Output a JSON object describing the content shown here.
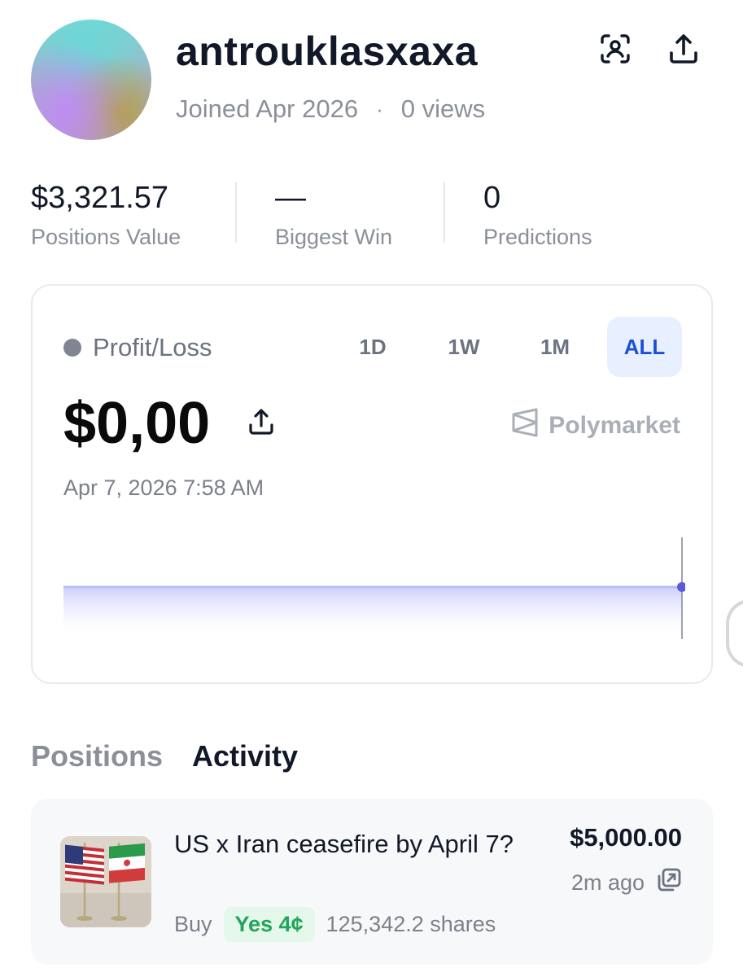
{
  "profile": {
    "username": "antrouklasxaxa",
    "joined": "Joined Apr 2026",
    "separator": "·",
    "views": "0 views"
  },
  "header_icons": [
    "face-scan-icon",
    "share-icon"
  ],
  "stats": [
    {
      "value": "$3,321.57",
      "label": "Positions Value"
    },
    {
      "value": "—",
      "label": "Biggest Win"
    },
    {
      "value": "0",
      "label": "Predictions"
    }
  ],
  "pnl": {
    "label": "Profit/Loss",
    "value": "$0,00",
    "timestamp": "Apr 7, 2026 7:58 AM",
    "brand": "Polymarket",
    "ranges": [
      "1D",
      "1W",
      "1M",
      "ALL"
    ],
    "selected_range": "ALL",
    "line_color": "#5b5bd6"
  },
  "tabs": {
    "positions": "Positions",
    "activity": "Activity"
  },
  "activity": [
    {
      "title": "US x Iran ceasefire by April 7?",
      "side": "Buy",
      "outcome": "Yes 4¢",
      "shares": "125,342.2 shares",
      "amount": "$5,000.00",
      "time": "2m ago"
    }
  ]
}
